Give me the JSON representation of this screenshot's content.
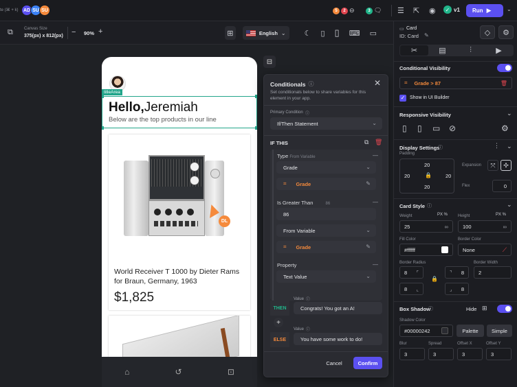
{
  "topbar": {
    "shortcut_hint": "te (⌘ + k)",
    "avatars": [
      {
        "initials": "AD",
        "color": "#5b50f0"
      },
      {
        "initials": "SU",
        "color": "#3b82f6"
      },
      {
        "initials": "SU",
        "color": "#f58a3c"
      }
    ],
    "badges": [
      {
        "count": "5",
        "color": "#f58a3c"
      },
      {
        "count": "2",
        "color": "#e0454f"
      },
      {
        "count": "3",
        "color": "#21b58a"
      }
    ],
    "version": "v1",
    "run_label": "Run"
  },
  "toolbar": {
    "canvas_size_label": "Canvas Size",
    "canvas_size_value": "375(px) x 812(px)",
    "zoom": "90%",
    "language": "English"
  },
  "phone": {
    "tag_label": "titleArea",
    "greeting_bold": "Hello,",
    "greeting_name": "Jeremiah",
    "subtitle": "Below are the top products in our line",
    "product_title": "World Receiver T 1000 by Dieter Rams for Braun, Germany, 1963",
    "product_price": "$1,825",
    "badge_initials": "DL"
  },
  "conditionals": {
    "title": "Conditionals",
    "description": "Set conditionals below to share variables for this element in your app.",
    "primary_condition_label": "Primary Condition",
    "primary_condition_value": "If/Then Statement",
    "if_this_label": "IF THIS",
    "type_label": "Type",
    "type_sub": "From Variable",
    "type_value": "Grade",
    "variable_1": "Grade",
    "greater_label": "Is Greater Than",
    "greater_sub": "86",
    "greater_value": "86",
    "from_variable": "From Variable",
    "variable_2": "Grade",
    "property_label": "Property",
    "property_value": "Text Value",
    "then_label": "THEN",
    "value_label_1": "Value",
    "then_value": "Congrats! You got an A!",
    "else_label": "ELSE",
    "value_label_2": "Value",
    "else_value": "You have some work to do!",
    "cancel_label": "Cancel",
    "confirm_label": "Confirm"
  },
  "right_panel": {
    "element_type": "Card",
    "element_id": "ID: Card",
    "conditional_visibility_title": "Conditional Visibility",
    "condition_chip": "Grade > 87",
    "show_in_builder": "Show in UI Builder",
    "responsive_visibility_title": "Responsive Visibility",
    "display_settings_title": "Display Settings",
    "padding_label": "Padding",
    "padding_top": "20",
    "padding_left": "20",
    "padding_right": "20",
    "padding_bottom": "20",
    "expansion_label": "Expansion",
    "flex_label": "Flex",
    "flex_value": "0",
    "card_style_title": "Card Style",
    "weight_label": "Weight",
    "weight_unit": "PX  %",
    "weight_value": "25",
    "height_label": "Height",
    "height_unit": "PX  %",
    "height_value": "100",
    "fill_color_label": "Fill Color",
    "fill_color_value": "#ffffff",
    "border_color_label": "Border Color",
    "border_color_value": "None",
    "border_radius_label": "Border Radius",
    "radius_tl": "8",
    "radius_tr": "8",
    "radius_bl": "8",
    "radius_br": "8",
    "border_width_label": "Border Width",
    "border_width_value": "2",
    "box_shadow_title": "Box Shadow",
    "hide_label": "Hide",
    "shadow_color_label": "Shadow Color",
    "shadow_color_value": "#00000242",
    "palette_label": "Palette",
    "simple_label": "Simple",
    "blur_label": "Blur",
    "blur_value": "3",
    "spread_label": "Spread",
    "spread_value": "3",
    "offset_x_label": "Offset X",
    "offset_x_value": "3",
    "offset_y_label": "Offset Y",
    "offset_y_value": "3"
  },
  "colors": {
    "accent": "#5b50f0",
    "danger": "#e0454f",
    "orange": "#f58a3c",
    "teal": "#21b58a"
  }
}
